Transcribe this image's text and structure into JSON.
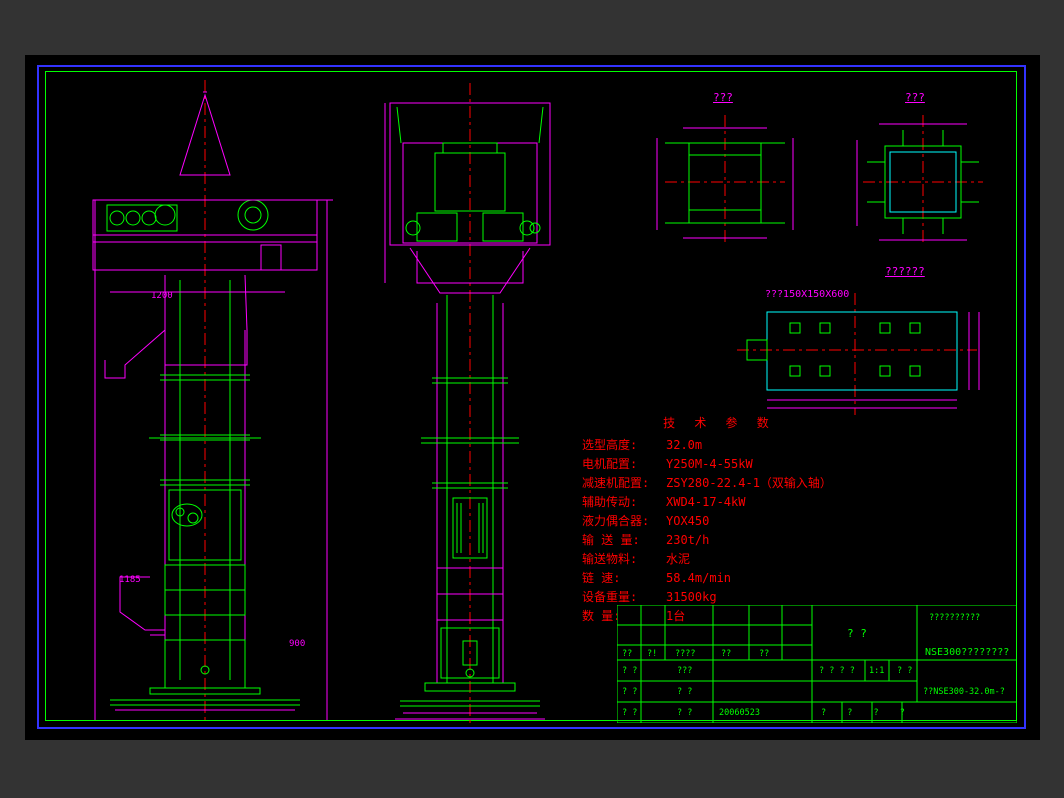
{
  "parameters": {
    "title": "技 术 参 数",
    "rows": [
      {
        "label": "选型高度:",
        "value": "32.0m"
      },
      {
        "label": "电机配置:",
        "value": "Y250M-4-55kW"
      },
      {
        "label": "减速机配置:",
        "value": "ZSY280-22.4-1（双输入轴）"
      },
      {
        "label": "辅助传动:",
        "value": "XWD4-17-4kW"
      },
      {
        "label": "液力偶合器:",
        "value": "YOX450"
      },
      {
        "label": "输 送 量:",
        "value": "230t/h"
      },
      {
        "label": "输送物料:",
        "value": "水泥"
      },
      {
        "label": "链  速:",
        "value": "58.4m/min"
      },
      {
        "label": "设备重量:",
        "value": "31500kg"
      },
      {
        "label": "数  量:",
        "value": "1台"
      }
    ]
  },
  "dimensions": {
    "top1": "???",
    "top2": "???",
    "top3": "??????",
    "steel": "???150X150X600",
    "d1200": "1200",
    "d1185": "1185",
    "d900": "900"
  },
  "titleblock": {
    "r1c1": "??",
    "r1c2": "?!",
    "r1c3": "????",
    "r1c4": "??",
    "r1c5": "??",
    "r2c1": "? ?",
    "r2c2": "???",
    "r3c1": "? ?",
    "r3c2": "? ?",
    "r4c1": "? ?",
    "r4c2": "? ?",
    "r4c3": "20060523",
    "sc": "? ? ? ?",
    "scv": "1:1",
    "mt": "? ?",
    "big": "?    ?",
    "nse": "NSE300????????",
    "proj": "??????????",
    "dwg": "??NSE300-32.0m-?",
    "rev": "?    ?    ?    ?"
  }
}
